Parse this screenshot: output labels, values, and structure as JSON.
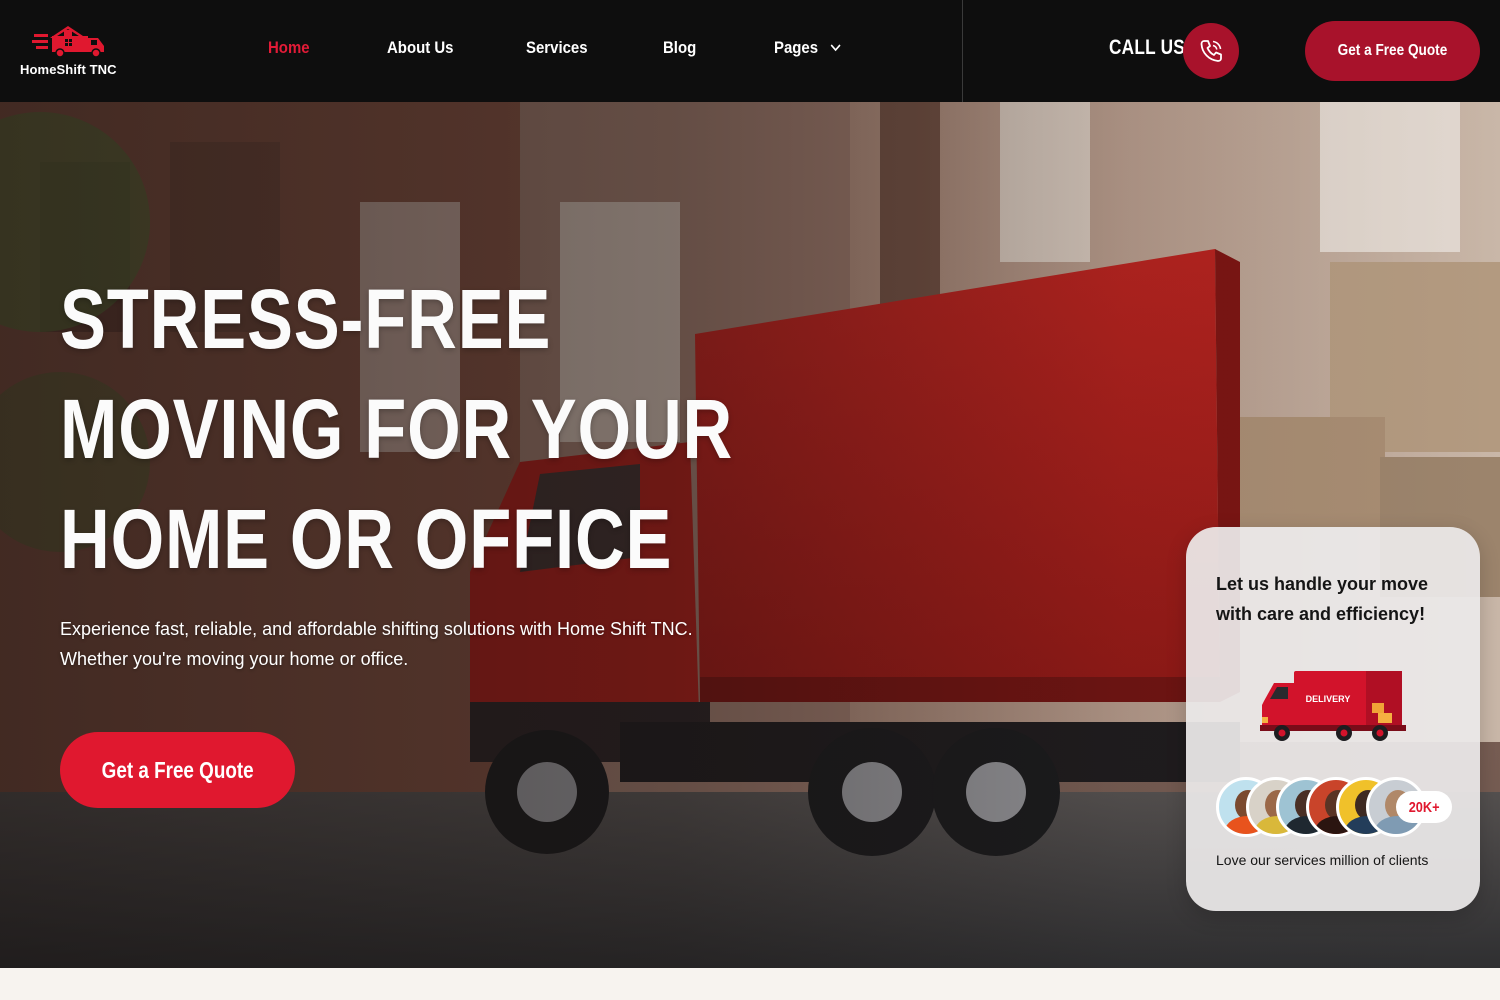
{
  "brand": {
    "name": "HomeShift TNC",
    "accent": "#e0182f",
    "dark_accent": "#a8122b",
    "header_bg": "#0e0e0e"
  },
  "nav": {
    "items": [
      {
        "label": "Home",
        "active": true
      },
      {
        "label": "About Us",
        "active": false
      },
      {
        "label": "Services",
        "active": false
      },
      {
        "label": "Blog",
        "active": false
      },
      {
        "label": "Pages",
        "active": false,
        "icon": "chevron-down-icon"
      }
    ]
  },
  "header": {
    "call_label": "CALL US",
    "call_icon": "phone-icon",
    "quote_label": "Get a Free Quote"
  },
  "hero": {
    "title_lines": [
      "STRESS-FREE",
      "MOVING FOR YOUR",
      "HOME OR OFFICE"
    ],
    "subtitle_line1": "Experience fast, reliable, and affordable shifting solutions with Home Shift TNC.",
    "subtitle_line2": "Whether you're moving your home or office.",
    "cta_label": "Get a Free Quote"
  },
  "card": {
    "text": "Let us handle your move with care and efficiency!",
    "truck_label": "DELIVERY",
    "badge": "20K+",
    "footer": "Love our services million of clients"
  }
}
